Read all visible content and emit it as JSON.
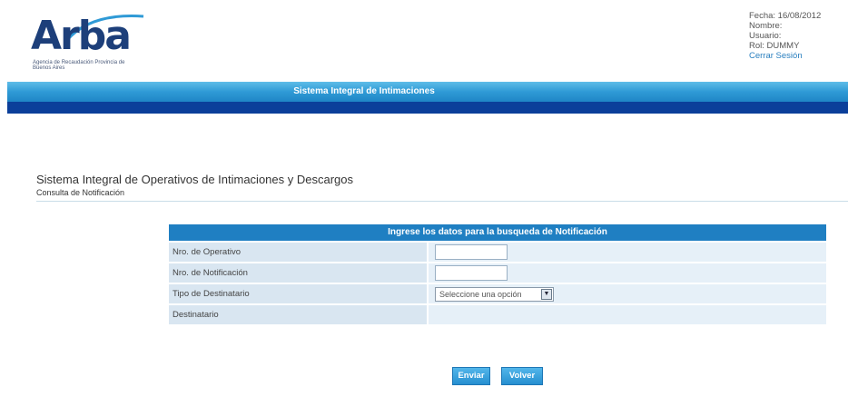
{
  "header": {
    "logo_text": "Arba",
    "logo_subtext": "Agencia de Recaudación Provincia de Buenos Aires",
    "fecha": "Fecha: 16/08/2012",
    "nombre": "Nombre:",
    "usuario": "Usuario:",
    "rol": "Rol: DUMMY",
    "logout_label": "Cerrar Sesión"
  },
  "banner": {
    "title": "Sistema Integral de Intimaciones"
  },
  "page": {
    "title": "Sistema Integral de Operativos de Intimaciones y Descargos",
    "subtitle": "Consulta de Notificación"
  },
  "form": {
    "header": "Ingrese los datos para la busqueda de Notificación",
    "rows": [
      {
        "label": "Nro. de Operativo",
        "value": ""
      },
      {
        "label": "Nro. de Notificación",
        "value": ""
      },
      {
        "label": "Tipo de Destinatario",
        "selected": "Seleccione una opción"
      },
      {
        "label": "Destinatario"
      }
    ]
  },
  "buttons": {
    "enviar": "Enviar",
    "volver": "Volver"
  },
  "colors": {
    "brand_blue": "#1d3f7a",
    "accent": "#1f7fc2",
    "banner_dark": "#0b3f9a"
  },
  "icons": {
    "logo_swoosh": "arc-swoosh",
    "select_arrow": "chevron-down-icon"
  }
}
